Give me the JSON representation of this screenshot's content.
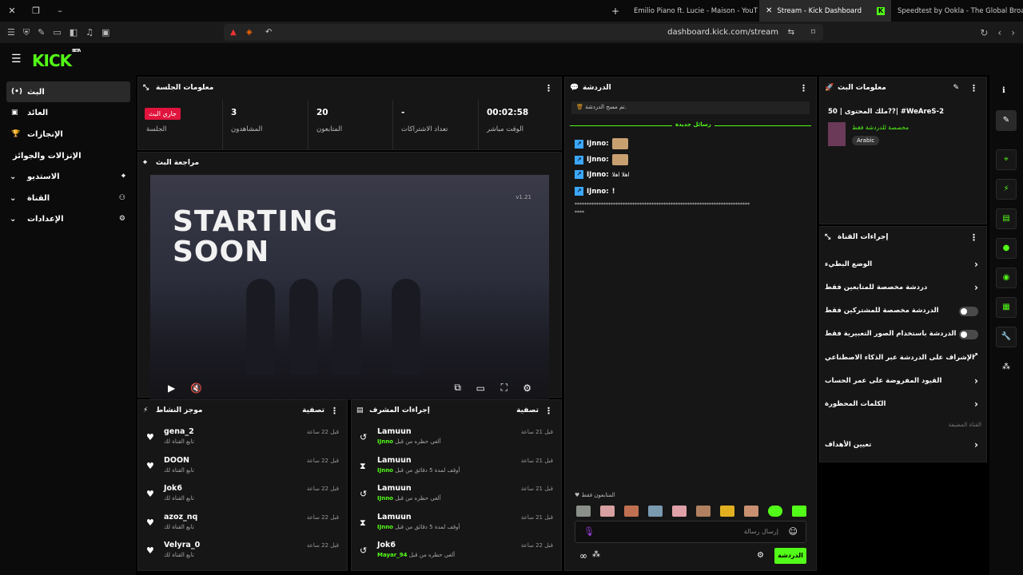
{
  "browser": {
    "tabs": [
      {
        "label": "Emilio Piano ft. Lucie - Maison - YouT",
        "active": false
      },
      {
        "label": "Stream - Kick Dashboard",
        "active": true
      },
      {
        "label": "Speedtest by Ookla - The Global Broad",
        "active": false
      }
    ],
    "url": "dashboard.kick.com/stream",
    "new_tab_icon": "plus-icon"
  },
  "app": {
    "logo": "KICK",
    "logo_sup": "BETA",
    "accent": "#53fc18"
  },
  "sidebar": {
    "items": [
      {
        "label": "البث",
        "icon": "(•)"
      },
      {
        "label": "العائد",
        "icon": "▣"
      },
      {
        "label": "الإنجازات",
        "icon": "🏆"
      },
      {
        "label": "الإنزالات والجوائز",
        "icon": ""
      },
      {
        "label": "الاستديو",
        "icon": "⌖"
      },
      {
        "label": "القناة",
        "icon": "⚇"
      },
      {
        "label": "الإعدادات",
        "icon": "⚙"
      }
    ]
  },
  "session": {
    "title": "معلومات الجلسة",
    "live_badge": "جاري البث",
    "session_label": "الجلسة",
    "stats": [
      {
        "value": "3",
        "label": "المشاهدون"
      },
      {
        "value": "20",
        "label": "المتابعون"
      },
      {
        "value": "-",
        "label": "تعداد الاشتراكات"
      },
      {
        "value": "00:02:58",
        "label": "الوقت مباشر"
      }
    ]
  },
  "preview": {
    "title": "مراجعة البث",
    "video_text_line1": "STARTING",
    "video_text_line2": "SOON",
    "version": "v1.21"
  },
  "activity": {
    "title": "موجز النشاط",
    "filter": "تصفية",
    "rows": [
      {
        "name": "gena_2",
        "sub": "تابع القناة لك",
        "time": "قبل 22 ساعة"
      },
      {
        "name": "DOON",
        "sub": "تابع القناة لك",
        "time": "قبل 22 ساعة"
      },
      {
        "name": "Jok6",
        "sub": "تابع القناة لك",
        "time": "قبل 22 ساعة"
      },
      {
        "name": "azoz_nq",
        "sub": "تابع القناة لك",
        "time": "قبل 22 ساعة"
      },
      {
        "name": "Velyra_0",
        "sub": "تابع القناة لك",
        "time": "قبل 22 ساعة"
      }
    ]
  },
  "mod": {
    "title": "إجراءات المشرف",
    "filter": "تصفية",
    "rows": [
      {
        "name": "Lamuun",
        "by": "IJnno",
        "sub": "ألغي حظره من قبل",
        "time": "قبل 21 ساعة",
        "icon": "↺"
      },
      {
        "name": "Lamuun",
        "by": "IJnno",
        "sub": "أوقف لمدة 5 دقائق من قبل",
        "time": "قبل 21 ساعة",
        "icon": "⧗"
      },
      {
        "name": "Lamuun",
        "by": "IJnno",
        "sub": "ألغي حظره من قبل",
        "time": "قبل 21 ساعة",
        "icon": "↺"
      },
      {
        "name": "Lamuun",
        "by": "IJnno",
        "sub": "أوقف لمدة 5 دقائق من قبل",
        "time": "قبل 21 ساعة",
        "icon": "⧗"
      },
      {
        "name": "Jok6",
        "by": "Mayar_94",
        "sub": "ألغي حظره من قبل",
        "time": "قبل 22 ساعة",
        "icon": "↺"
      }
    ]
  },
  "chat": {
    "title": "الدردشة",
    "cleared": "تم مسح الدردشة.",
    "new_messages": "رسائل جديدة",
    "lines": [
      {
        "user": "IJnno:",
        "text": ""
      },
      {
        "user": "IJnno:",
        "text": ""
      },
      {
        "user": "IJnno:",
        "text": "اهلا اهلا"
      },
      {
        "user": "IJnno:",
        "text": "!"
      }
    ],
    "long_line": "*************************************************************************",
    "long_line_end": "****",
    "followers_only": "المتابعون فقط",
    "placeholder": "إرسال رسالة",
    "send": "الدردشة"
  },
  "stream_info": {
    "title": "معلومات البث",
    "stream_title": "ملك المحتوى | 50??| #WeAreS-2",
    "category": "مخصصة للدردشة فقط",
    "language": "Arabic"
  },
  "channel_actions": {
    "title": "إجراءات القناة",
    "rows": [
      {
        "label": "الوضع البطيء",
        "type": "arrow"
      },
      {
        "label": "دردشة مخصصة للمتابعين فقط",
        "type": "arrow"
      },
      {
        "label": "الدردشة مخصصة للمشتركين فقط",
        "type": "toggle"
      },
      {
        "label": "الدردشة باستخدام الصور التعبيرية فقط",
        "type": "toggle"
      },
      {
        "label": "الإشراف على الدردشة عبر الذكاء الاصطناعي",
        "type": "external"
      },
      {
        "label": "القيود المفروضة على عمر الحساب",
        "type": "arrow"
      },
      {
        "label": "الكلمات المحظورة",
        "type": "arrow"
      }
    ],
    "section": "القناة المضيفة",
    "goals": "تعيين الأهداف"
  }
}
